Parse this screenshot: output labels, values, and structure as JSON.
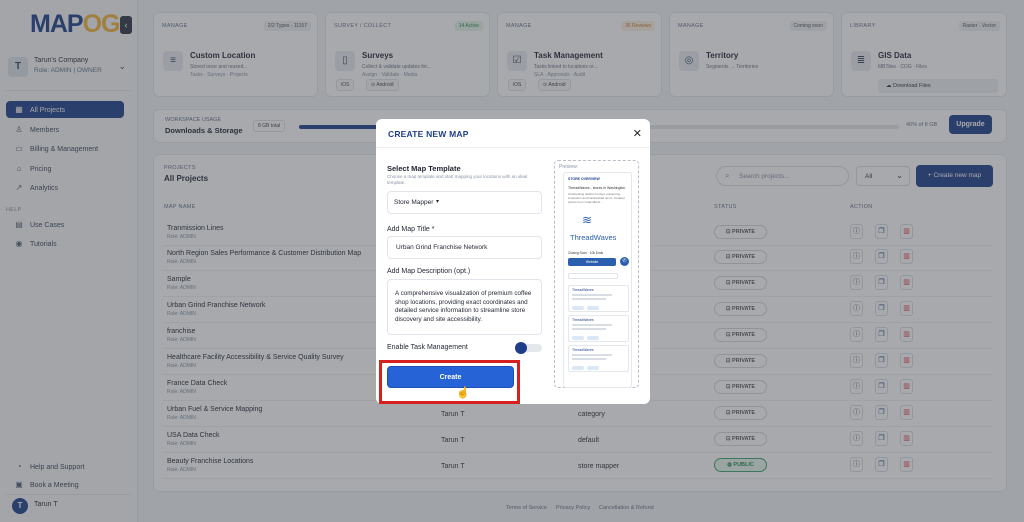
{
  "app": {
    "logo_main": "MAP",
    "logo_accent": "OG",
    "collapse_icon": "‹"
  },
  "company": {
    "initial": "T",
    "name": "Tarun's Company",
    "role": "Role: ADMIN | OWNER"
  },
  "nav": [
    {
      "label": "All Projects",
      "icon": "grid-icon",
      "glyph": "▦",
      "active": true
    },
    {
      "label": "Members",
      "icon": "user-icon",
      "glyph": "♙"
    },
    {
      "label": "Billing & Management",
      "icon": "card-icon",
      "glyph": "▭"
    },
    {
      "label": "Pricing",
      "icon": "tag-icon",
      "glyph": "⌂"
    },
    {
      "label": "Analytics",
      "icon": "chart-icon",
      "glyph": "↗"
    }
  ],
  "help_section": {
    "title": "HELP",
    "items": [
      {
        "label": "Use Cases",
        "icon": "book-icon",
        "glyph": "▤"
      },
      {
        "label": "Tutorials",
        "icon": "play-icon",
        "glyph": "◉"
      }
    ]
  },
  "bottom_nav": [
    {
      "label": "Help and Support",
      "icon": "help-icon",
      "glyph": "◔"
    },
    {
      "label": "Book a Meeting",
      "icon": "calendar-icon",
      "glyph": "▣"
    }
  ],
  "user": {
    "initial": "T",
    "name": "Tarun T"
  },
  "modules": [
    {
      "cat": "MANAGE",
      "badge": "2/2 Types · 11157",
      "title": "Custom Location",
      "d1": "Stored once and reused...",
      "d2": "Tasks · Surveys · Projects",
      "icon": "database-icon",
      "glyph": "≡"
    },
    {
      "cat": "SURVEY / COLLECT",
      "badge": "14 Active",
      "title": "Surveys",
      "d1": "Collect & validate updates for...",
      "d2": "Assign · Validate · Media",
      "icon": "clipboard-icon",
      "glyph": "▯",
      "chips": [
        "iOS",
        "Android"
      ]
    },
    {
      "cat": "MANAGE",
      "badge": "36 Reviews",
      "title": "Task Management",
      "d1": "Tasks linked to locations or...",
      "d2": "SLA · Approvals · Audit",
      "icon": "checkbox-icon",
      "glyph": "☑",
      "chips": [
        "iOS",
        "Android"
      ]
    },
    {
      "cat": "MANAGE",
      "badge": "Coming soon",
      "title": "Territory",
      "d1": "Segments → Territories",
      "d2": "",
      "icon": "pin-icon",
      "glyph": "◎"
    },
    {
      "cat": "LIBRARY",
      "badge": "Raster · Vector",
      "title": "GIS Data",
      "d1": "MBTiles · COG · Files",
      "d2": "",
      "icon": "layers-icon",
      "glyph": "≣",
      "button": "Download Files"
    }
  ],
  "usage": {
    "cat": "WORKSPACE USAGE",
    "title": "Downloads & Storage",
    "badge": "8 GB total",
    "percent_text": "40% of 8 GB",
    "fraction": 0.4,
    "upgrade": "Upgrade"
  },
  "projects": {
    "cat": "PROJECTS",
    "title": "All Projects",
    "search_placeholder": "Search projects...",
    "filter": "All",
    "create_button": "+ Create new map",
    "columns": {
      "name": "MAP NAME",
      "status": "STATUS",
      "action": "ACTION"
    },
    "rows": [
      {
        "name": "Tranmission Lines",
        "role": "Role: ADMIN",
        "owner": "",
        "type": "",
        "status": "PRIVATE"
      },
      {
        "name": "North Region Sales Performance & Customer Distribution Map",
        "role": "Role: ADMIN",
        "owner": "",
        "type": "",
        "status": "PRIVATE"
      },
      {
        "name": "Sample",
        "role": "Role: ADMIN",
        "owner": "",
        "type": "",
        "status": "PRIVATE"
      },
      {
        "name": "Urban Grind Franchise Network",
        "role": "Role: ADMIN",
        "owner": "",
        "type": "",
        "status": "PRIVATE"
      },
      {
        "name": "franchise",
        "role": "Role: ADMIN",
        "owner": "",
        "type": "",
        "status": "PRIVATE"
      },
      {
        "name": "Healthcare Facility Accessibility & Service Quality Survey",
        "role": "Role: ADMIN",
        "owner": "",
        "type": "",
        "status": "PRIVATE"
      },
      {
        "name": "France Data Check",
        "role": "Role: ADMIN",
        "owner": "",
        "type": "",
        "status": "PRIVATE"
      },
      {
        "name": "Urban Fuel & Service Mapping",
        "role": "Role: ADMIN",
        "owner": "Tarun T",
        "type": "category",
        "status": "PRIVATE"
      },
      {
        "name": "USA Data Check",
        "role": "Role: ADMIN",
        "owner": "Tarun T",
        "type": "default",
        "status": "PRIVATE"
      },
      {
        "name": "Beauty Franchise Locations",
        "role": "Role: ADMIN",
        "owner": "Tarun T",
        "type": "store mapper",
        "status": "PUBLIC"
      }
    ]
  },
  "footer": [
    "Terms of Service",
    "Privacy Policy",
    "Cancellation & Refund"
  ],
  "modal": {
    "title": "CREATE NEW MAP",
    "close": "✕",
    "template_label": "Select Map Template",
    "template_help": "Choose a map template and start mapping your locations with an ideal template.",
    "template_value": "Store Mapper",
    "map_title_label": "Add Map Title *",
    "map_title_value": "Urban Grind Franchise Network",
    "desc_label": "Add Map Description (opt.)",
    "desc_value": "A comprehensive visualization of premium coffee shop locations, providing exact coordinates and detailed service information to streamline store discovery and site accessibility.",
    "task_label": "Enable Task Management",
    "task_enabled": false,
    "create_label": "Create",
    "preview": {
      "label": "Preview:",
      "overview": "STORE OVERVIEW",
      "store_name": "ThreadWaves - stores in Washington",
      "store_desc": "Outstanding fashion houses presenting inspiration and handcrafted items. Curated pieces from small labels...",
      "brand": "ThreadWaves",
      "closing": "Closing Soon · 10k Ends",
      "website": "Website",
      "card_title": "ThreadWaves"
    }
  }
}
